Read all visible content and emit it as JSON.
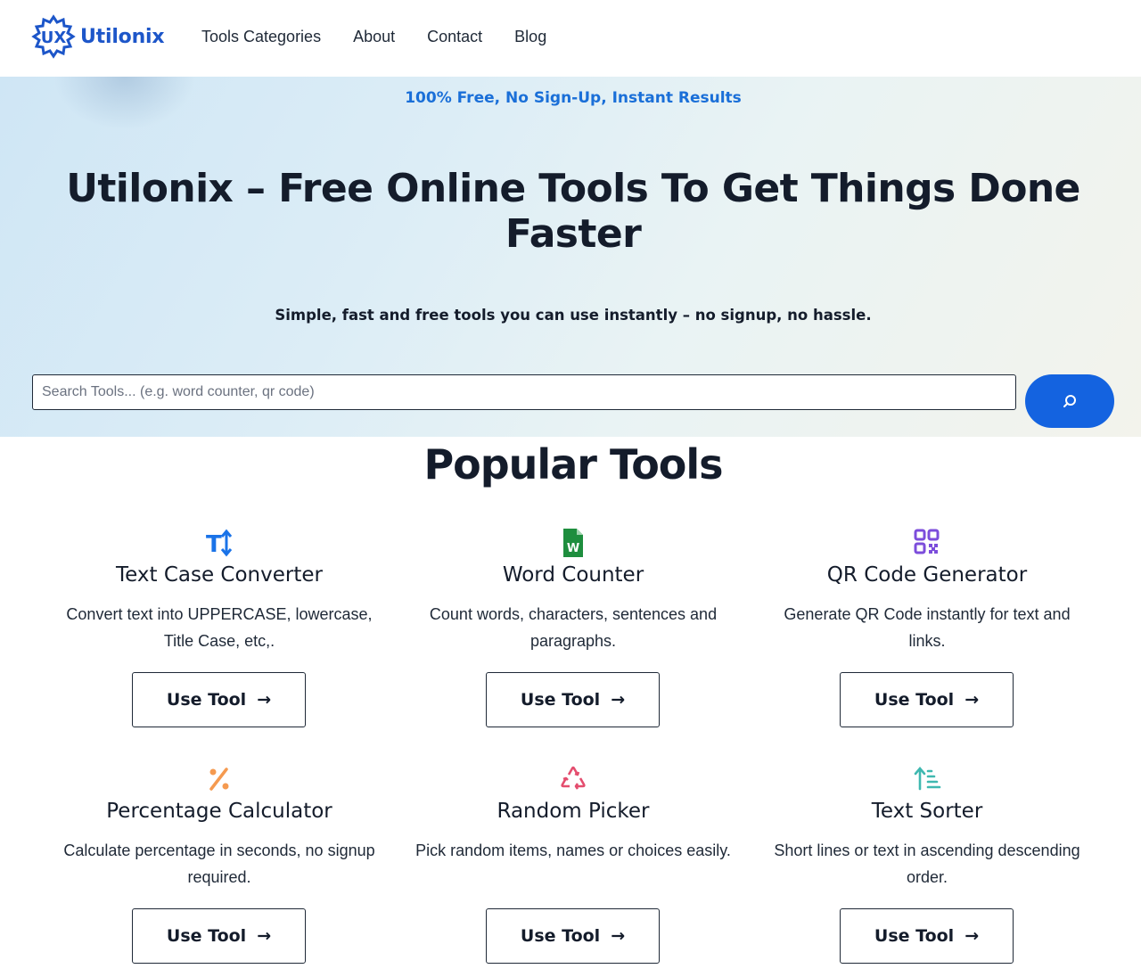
{
  "header": {
    "logo_text": "Utilonix",
    "nav": [
      "Tools Categories",
      "About",
      "Contact",
      "Blog"
    ]
  },
  "hero": {
    "tagline": "100% Free, No Sign-Up, Instant Results",
    "title": "Utilonix – Free Online Tools To Get Things Done Faster",
    "subtitle": "Simple, fast and free tools you can use instantly – no signup, no hassle.",
    "search_placeholder": "Search Tools... (e.g. word counter, qr code)"
  },
  "popular": {
    "title": "Popular Tools",
    "tools": [
      {
        "icon": "text-case-icon",
        "title": "Text Case Converter",
        "desc": "Convert text into UPPERCASE, lowercase, Title Case, etc,.",
        "button": "Use Tool",
        "color": "#1a73e8"
      },
      {
        "icon": "word-document-icon",
        "title": "Word Counter",
        "desc": "Count words, characters, sentences and paragraphs.",
        "button": "Use Tool",
        "color": "#1e8e3e"
      },
      {
        "icon": "qr-code-icon",
        "title": "QR Code Generator",
        "desc": "Generate QR Code instantly for text and links.",
        "button": "Use Tool",
        "color": "#7c4ddb"
      },
      {
        "icon": "percent-icon",
        "title": "Percentage Calculator",
        "desc": "Calculate percentage in seconds, no signup required.",
        "button": "Use Tool",
        "color": "#f59a50"
      },
      {
        "icon": "recycle-icon",
        "title": "Random Picker",
        "desc": "Pick random items, names or choices easily.",
        "button": "Use Tool",
        "color": "#e44d6e"
      },
      {
        "icon": "sort-ascending-icon",
        "title": "Text Sorter",
        "desc": "Short lines or text in ascending descending order.",
        "button": "Use Tool",
        "color": "#3fb8b0"
      }
    ]
  }
}
